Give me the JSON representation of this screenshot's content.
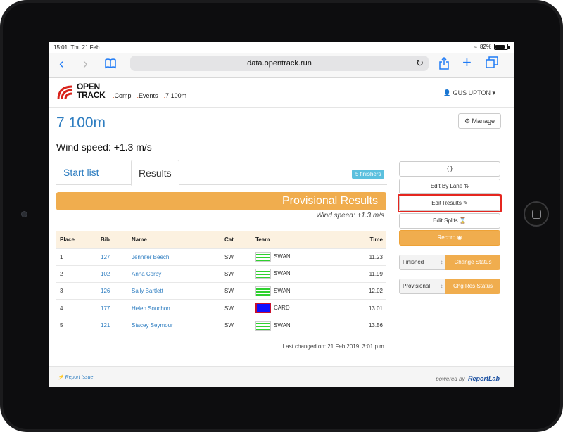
{
  "status": {
    "time": "15:01",
    "date": "Thu 21 Feb",
    "battery": "82%",
    "battery_level": 0.82
  },
  "browser": {
    "url": "data.opentrack.run"
  },
  "site": {
    "logo_lines": [
      "OPEN",
      "TRACK"
    ],
    "crumbs": [
      "Comp",
      "Events",
      "7 100m"
    ],
    "user": "GUS UPTON"
  },
  "page": {
    "title": "7 100m",
    "manage_label": "Manage",
    "wind_speed": "Wind speed: +1.3 m/s"
  },
  "tabs": {
    "start_list": "Start list",
    "results": "Results",
    "finishers_badge": "5 finishers"
  },
  "results_banner": {
    "title": "Provisional Results",
    "wind": "Wind speed: +1.3 m/s"
  },
  "table": {
    "headers": {
      "place": "Place",
      "bib": "Bib",
      "name": "Name",
      "cat": "Cat",
      "team": "Team",
      "time": "Time"
    },
    "rows": [
      {
        "place": "1",
        "bib": "127",
        "name": "Jennifer Beech",
        "cat": "SW",
        "team": "SWAN",
        "flag": "swan",
        "time": "11.23"
      },
      {
        "place": "2",
        "bib": "102",
        "name": "Anna Corby",
        "cat": "SW",
        "team": "SWAN",
        "flag": "swan",
        "time": "11.99"
      },
      {
        "place": "3",
        "bib": "126",
        "name": "Sally Bartlett",
        "cat": "SW",
        "team": "SWAN",
        "flag": "swan",
        "time": "12.02"
      },
      {
        "place": "4",
        "bib": "177",
        "name": "Helen Souchon",
        "cat": "SW",
        "team": "CARD",
        "flag": "card",
        "time": "13.01"
      },
      {
        "place": "5",
        "bib": "121",
        "name": "Stacey Seymour",
        "cat": "SW",
        "team": "SWAN",
        "flag": "swan",
        "time": "13.56"
      }
    ],
    "last_changed": "Last changed on: 21 Feb 2019, 3:01 p.m."
  },
  "sidebar": {
    "json_button": "{ }",
    "edit_by_lane": "Edit By Lane",
    "edit_results": "Edit Results",
    "edit_splits": "Edit Splits",
    "record": "Record",
    "status_value": "Finished",
    "change_status": "Change Status",
    "res_status_value": "Provisional",
    "chg_res_status": "Chg Res Status"
  },
  "footer": {
    "report_issue": "Report Issue",
    "powered_by": "powered by",
    "brand": "ReportLab"
  },
  "colors": {
    "accent": "#2f7ec1",
    "warning": "#f0ad4e",
    "info": "#5bc0de",
    "highlight": "#e5261f"
  }
}
